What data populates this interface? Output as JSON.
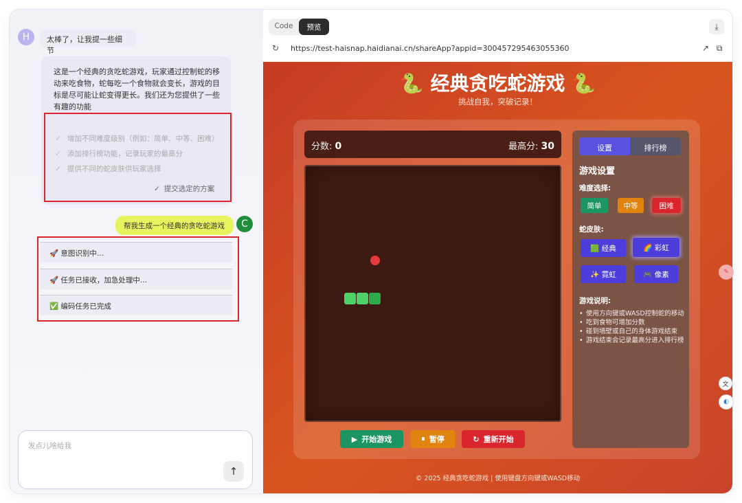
{
  "chat": {
    "user_avatar": "H",
    "top_message": "太棒了，让我提一些细节",
    "ai_text": "这是一个经典的贪吃蛇游戏，玩家通过控制蛇的移动来吃食物，蛇每吃一个食物就会变长，游戏的目标是尽可能让蛇变得更长。我们还为您提供了一些有趣的功能",
    "options": [
      "增加不同难度级别（例如：简单、中等、困难）",
      "添加排行榜功能，记录玩家的最高分",
      "提供不同的蛇皮肤供玩家选择"
    ],
    "submit_label": "提交选定的方案",
    "user_message": "帮我生成一个经典的贪吃蛇游戏",
    "bot_avatar": "C",
    "status": [
      "🚀 意图识别中...",
      "🚀 任务已接收，加急处理中...",
      "✅ 编码任务已完成"
    ],
    "input_placeholder": "发点儿啥给我"
  },
  "preview": {
    "tabs": [
      "Code",
      "预览"
    ],
    "url": "https://test-haisnap.haidianai.cn/shareApp?appid=300457295463055360"
  },
  "game": {
    "title": "🐍 经典贪吃蛇游戏 🐍",
    "subtitle": "挑战自我，突破记录！",
    "score_label": "分数:",
    "score": "0",
    "high_label": "最高分:",
    "high": "30",
    "buttons": {
      "start": "开始游戏",
      "pause": "暂停",
      "restart": "重新开始"
    },
    "side_tabs": [
      "设置",
      "排行榜"
    ],
    "settings_title": "游戏设置",
    "difficulty_label": "难度选择:",
    "difficulty": [
      "简单",
      "中等",
      "困难"
    ],
    "skin_label": "蛇皮肤:",
    "skins": [
      "🟩 经典",
      "🌈 彩虹",
      "✨ 霓虹",
      "🎮 像素"
    ],
    "rules_label": "游戏说明:",
    "rules": [
      "使用方向键或WASD控制蛇的移动",
      "吃到食物可增加分数",
      "碰到墙壁或自己的身体游戏结束",
      "游戏结束会记录最高分进入排行榜"
    ],
    "footer": "© 2025 经典贪吃蛇游戏 | 使用键盘方向键或WASD移动"
  },
  "colors": {
    "accent": "#5b53e0",
    "start": "#1b9663",
    "pause": "#e1830f",
    "restart": "#d9262c",
    "highlight_box": "#d9262c"
  }
}
